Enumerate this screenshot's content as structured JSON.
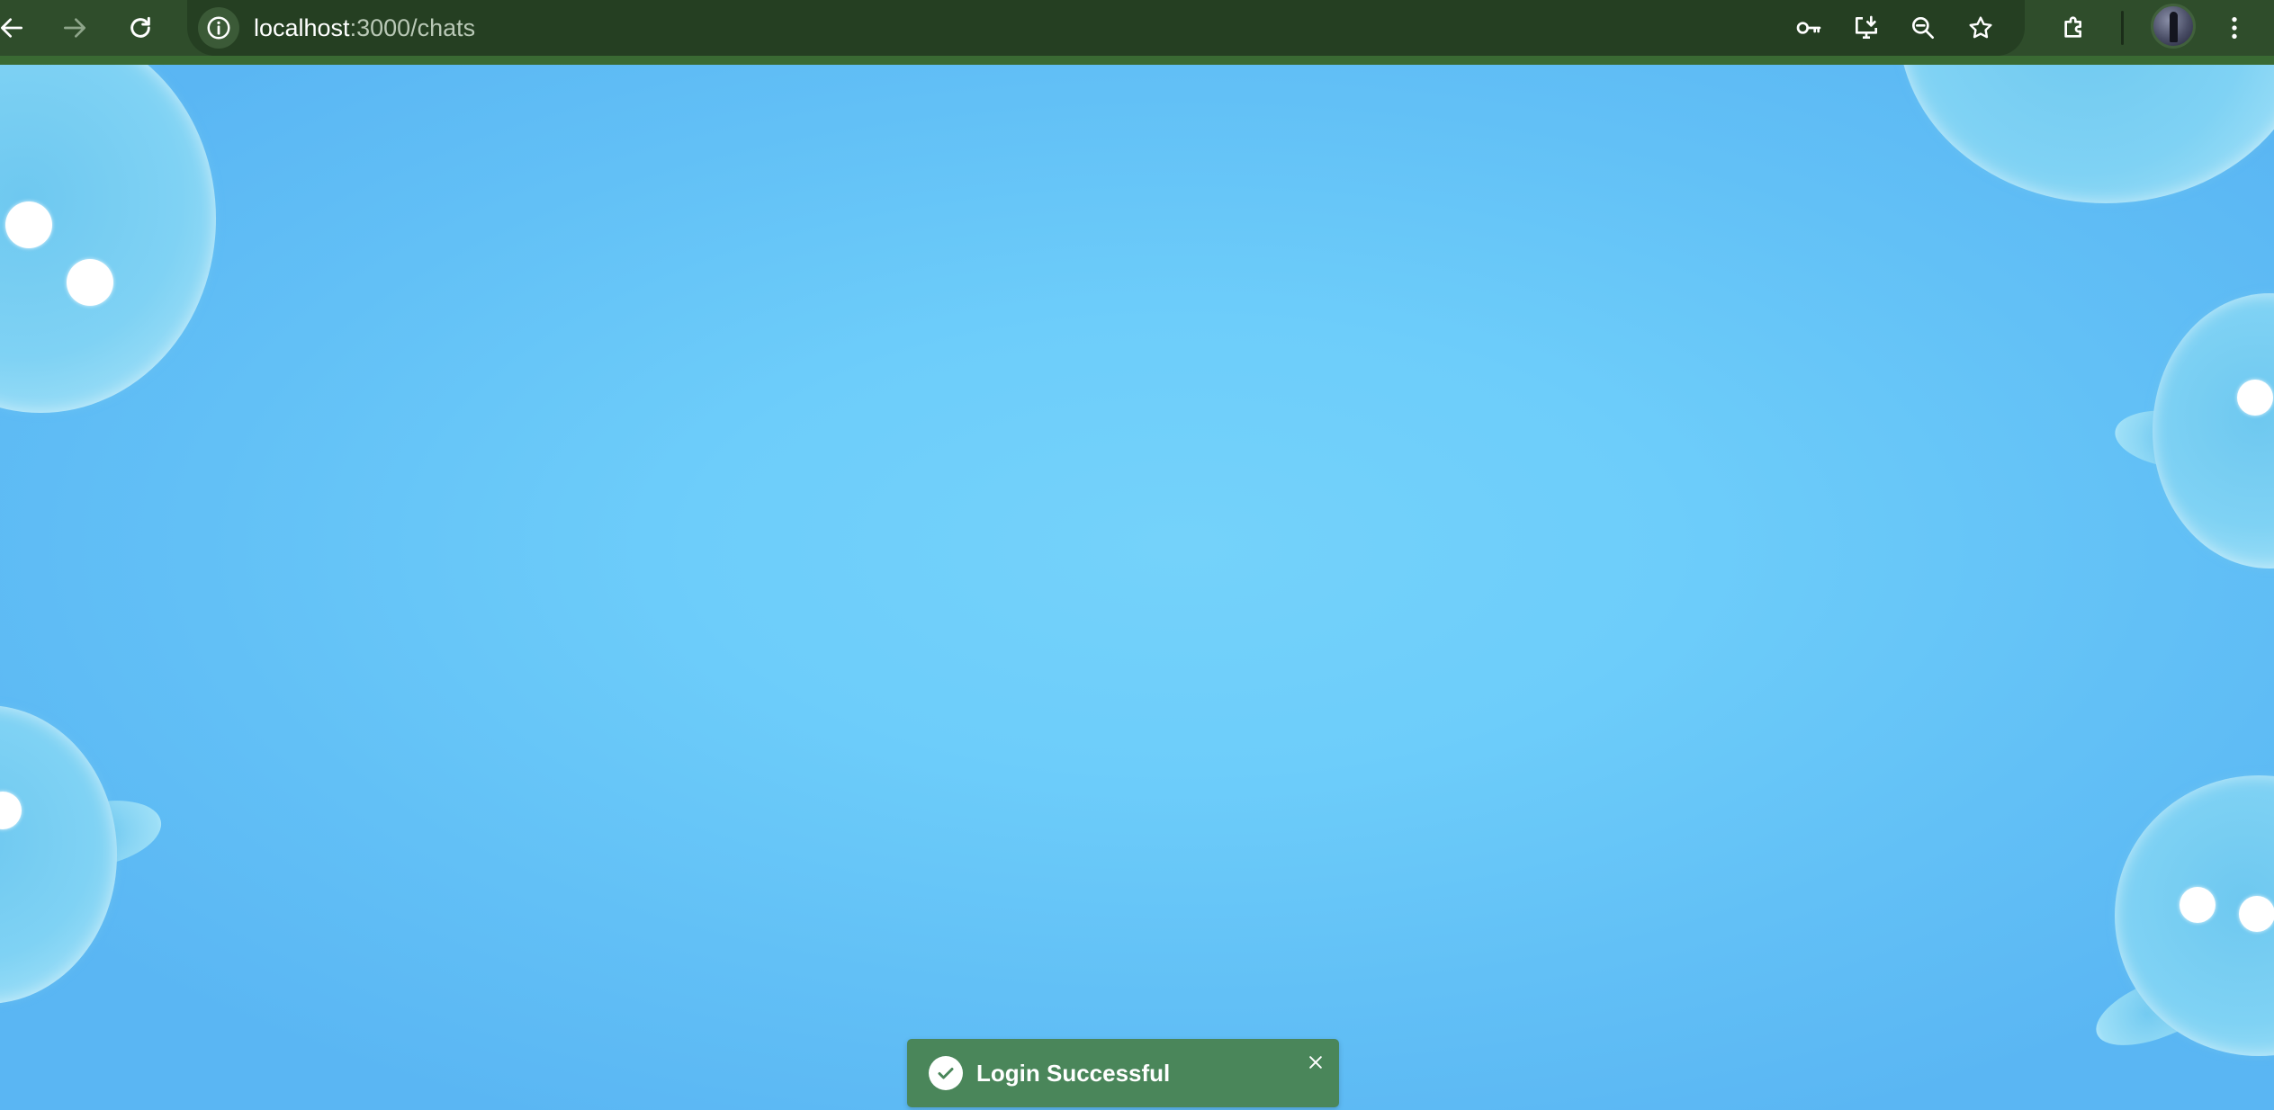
{
  "browser": {
    "url_host": "localhost",
    "url_path": ":3000/chats",
    "buttons": [
      "back-icon",
      "forward-icon",
      "reload-icon"
    ],
    "omnibox_icons": [
      "key-icon",
      "install-app-icon",
      "zoom-out-icon",
      "bookmark-star-icon"
    ],
    "toolbar_icons": [
      "extensions-icon",
      "profile-avatar",
      "more-menu-icon"
    ]
  },
  "toast": {
    "message": "Login Successful",
    "icon": "check-circle-icon",
    "close_icon": "close-icon",
    "color": "#4a865a"
  },
  "theme": {
    "toolbar_bg": "#2f4d2b",
    "page_bg": "#6dcdfa"
  }
}
